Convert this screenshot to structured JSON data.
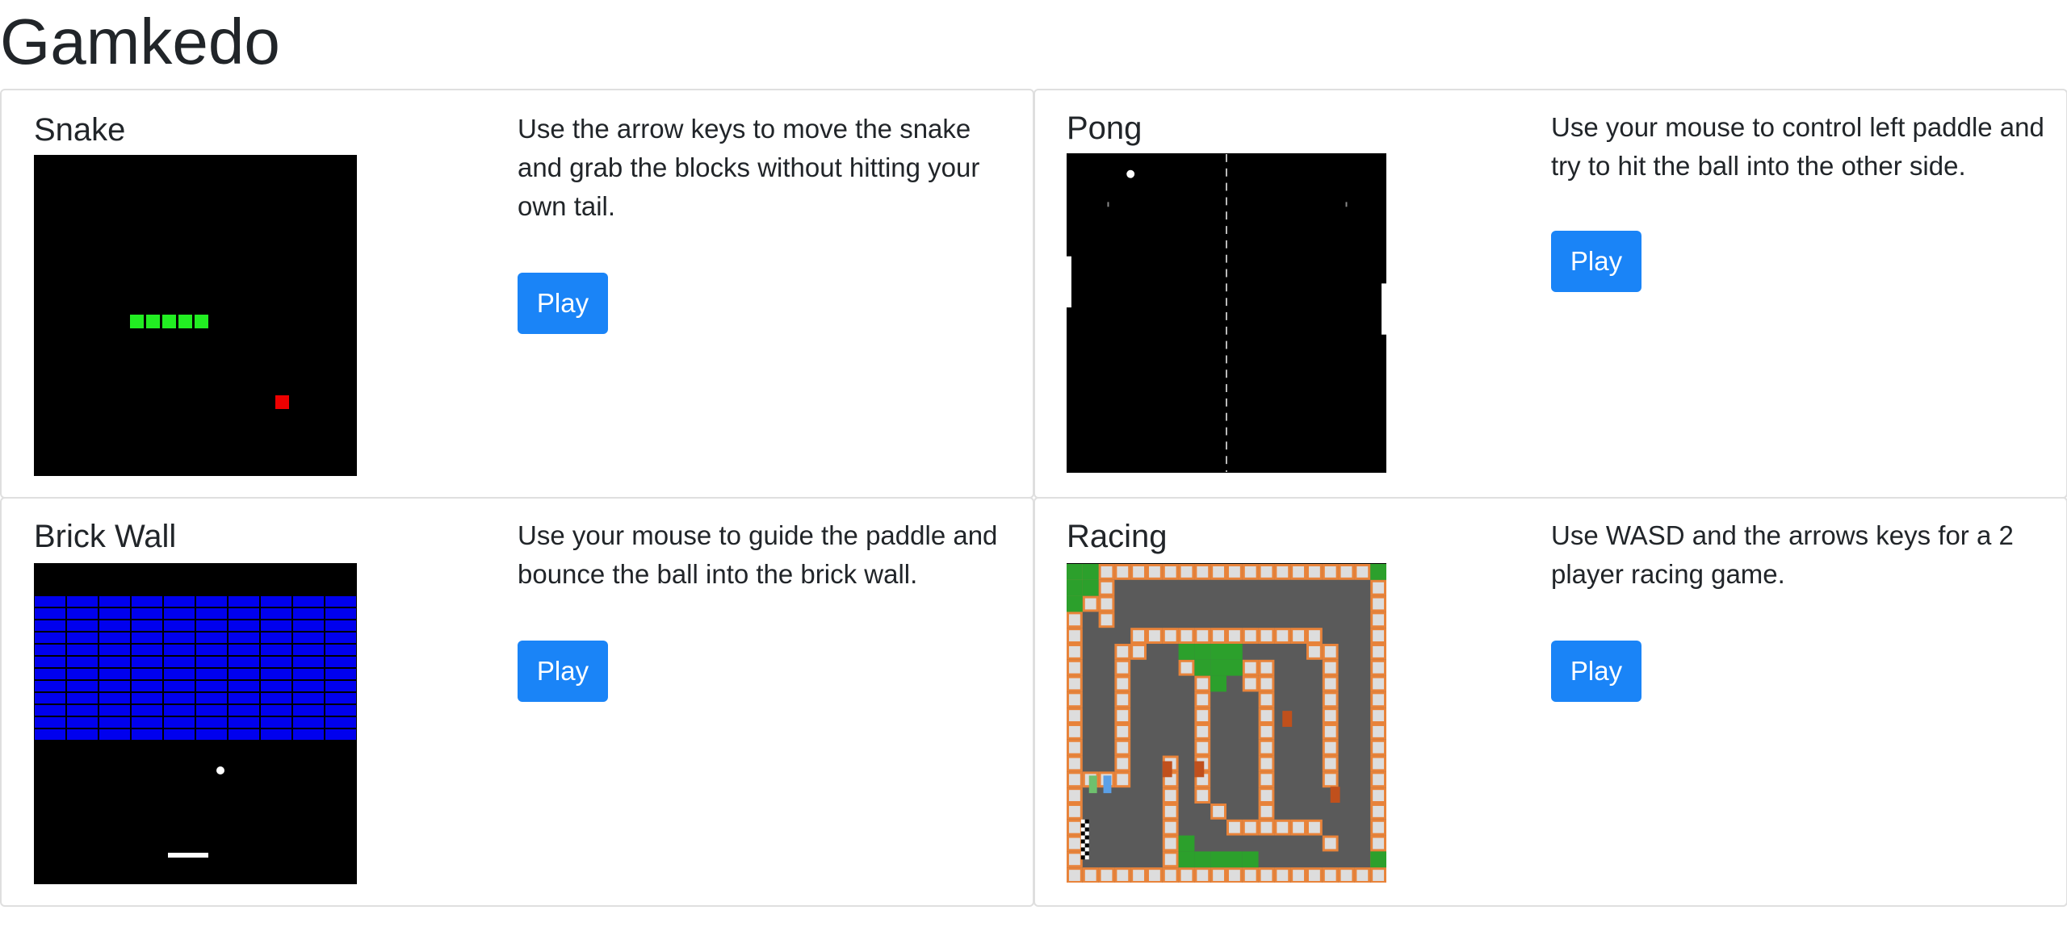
{
  "page": {
    "title": "Gamkedo"
  },
  "games": [
    {
      "id": "snake",
      "title": "Snake",
      "description": "Use the arrow keys to move the snake and grab the blocks without hitting your own tail.",
      "play_label": "Play"
    },
    {
      "id": "pong",
      "title": "Pong",
      "description": "Use your mouse to control left paddle and try to hit the ball into the other side.",
      "play_label": "Play"
    },
    {
      "id": "brick-wall",
      "title": "Brick Wall",
      "description": "Use your mouse to guide the paddle and bounce the ball into the brick wall.",
      "play_label": "Play"
    },
    {
      "id": "racing",
      "title": "Racing",
      "description": "Use WASD and the arrows keys for a 2 player racing game.",
      "play_label": "Play"
    }
  ],
  "colors": {
    "primary_button": "#1a84f7",
    "snake_body": "#22ee22",
    "snake_food": "#ee0000",
    "bricks": "#0000ee",
    "track_border": "#e8833a",
    "grass": "#2ca02c"
  }
}
